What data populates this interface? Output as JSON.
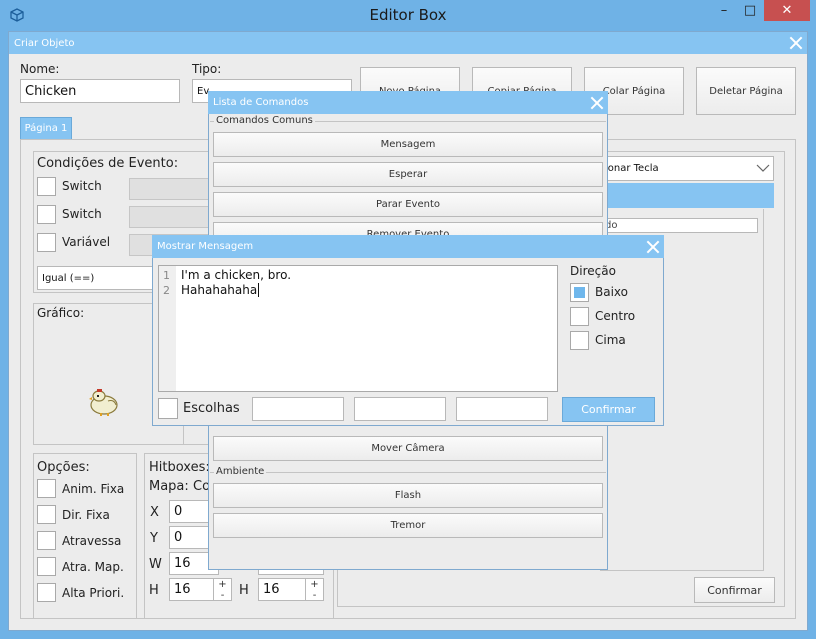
{
  "window": {
    "title": "Editor Box",
    "minimize": "–",
    "restore": "□",
    "close": "✕"
  },
  "criar": {
    "title": "Criar Objeto",
    "nome_label": "Nome:",
    "nome_value": "Chicken",
    "tipo_label": "Tipo:",
    "tipo_value": "Ev",
    "page_buttons": [
      "Novo Página",
      "Copiar Página",
      "Colar Página",
      "Deletar Página"
    ],
    "tab": "Página 1",
    "condicoes_label": "Condições de Evento:",
    "cond_switch1": "Switch",
    "cond_switch2": "Switch",
    "cond_variavel": "Variável",
    "igual": "Igual (==)",
    "grafico_label": "Gráfico:",
    "opcoes_label": "Opções:",
    "opcoes": [
      "Anim. Fixa",
      "Dir. Fixa",
      "Atravessa",
      "Atra. Map.",
      "Alta Priori."
    ],
    "hitboxes_label": "Hitboxes:",
    "mapa_label": "Mapa:",
    "mapa_value": "Co",
    "x_label": "X",
    "x_value": "0",
    "y_label": "Y",
    "y_value": "0",
    "w_label": "W",
    "w_value": "16",
    "h_label": "H",
    "h_value": "16",
    "h2_label": "H",
    "h2_value": "16",
    "right_combo": "ionar Tecla",
    "right_field": "do",
    "confirmar": "Confirmar"
  },
  "lista": {
    "title": "Lista de Comandos",
    "comuns_label": "Comandos Comuns",
    "comuns": [
      "Mensagem",
      "Esperar",
      "Parar Evento",
      "Remover Evento"
    ],
    "mover_camera": "Mover Câmera",
    "ambiente_label": "Ambiente",
    "ambiente": [
      "Flash",
      "Tremor"
    ]
  },
  "mostrar": {
    "title": "Mostrar Mensagem",
    "line_numbers": [
      "1",
      "2"
    ],
    "lines": [
      "I'm a chicken, bro.",
      "Hahahahaha"
    ],
    "direcao_label": "Direção",
    "direcoes": [
      "Baixo",
      "Centro",
      "Cima"
    ],
    "escolhas_label": "Escolhas",
    "confirmar": "Confirmar"
  },
  "colors": {
    "accent": "#86c4f2",
    "titlebar": "#6fb2e6",
    "close": "#c75050"
  }
}
